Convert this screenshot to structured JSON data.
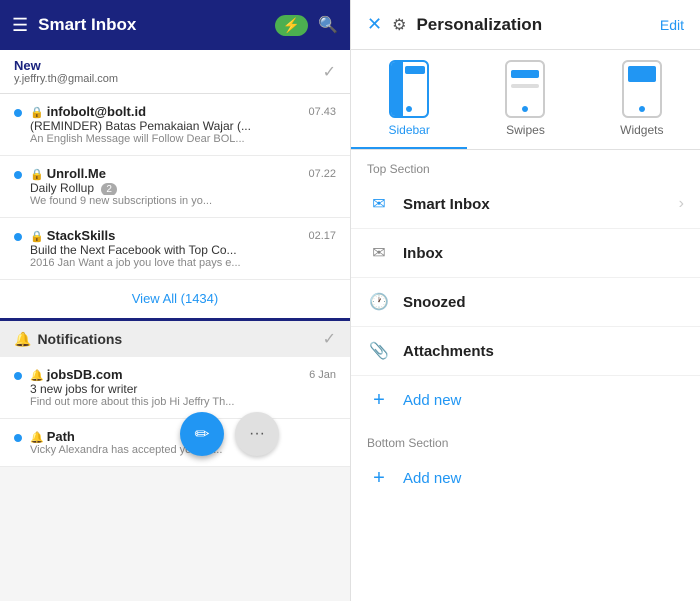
{
  "left": {
    "header": {
      "title": "Smart Inbox",
      "menu_icon": "☰",
      "search_icon": "🔍",
      "bolt_icon": "⚡"
    },
    "new_section": {
      "label": "New",
      "email": "y.jeffry.th@gmail.com",
      "check_icon": "○✓"
    },
    "emails": [
      {
        "sender": "infobolt@bolt.id",
        "time": "07.43",
        "subject": "(REMINDER) Batas Pemakaian Wajar (...",
        "preview": "An English Message will Follow Dear BOL...",
        "has_dot": true
      },
      {
        "sender": "Unroll.Me",
        "time": "07.22",
        "subject": "Daily Rollup",
        "preview": "We found 9 new subscriptions in yo...",
        "badge": "2",
        "has_dot": true
      },
      {
        "sender": "StackSkills",
        "time": "02.17",
        "subject": "Build the Next Facebook with Top Co...",
        "preview": "2016 Jan Want a job you love that pays e...",
        "has_dot": true
      }
    ],
    "view_all": "View All (1434)",
    "notifications_section": {
      "title": "Notifications"
    },
    "notifications": [
      {
        "sender": "jobsDB.com",
        "time": "6 Jan",
        "subject": "3 new jobs for writer",
        "preview": "Find out more about this job Hi Jeffry Th...",
        "has_dot": true
      },
      {
        "sender": "Path",
        "time": "",
        "subject": "",
        "preview": "Vicky Alexandra has accepted your fri...",
        "has_dot": true
      }
    ],
    "fab_icon": "✏",
    "more_icon": "···"
  },
  "right": {
    "header": {
      "close_icon": "✕",
      "personalize_icon": "⚙",
      "title": "Personalization",
      "edit_label": "Edit"
    },
    "tabs": [
      {
        "label": "Sidebar",
        "active": true,
        "type": "sidebar"
      },
      {
        "label": "Swipes",
        "active": false,
        "type": "swipes"
      },
      {
        "label": "Widgets",
        "active": false,
        "type": "widgets"
      }
    ],
    "top_section_label": "Top Section",
    "menu_items": [
      {
        "icon": "✉",
        "icon_color": "#2196f3",
        "text": "Smart Inbox",
        "has_chevron": true
      },
      {
        "icon": "✉",
        "icon_color": "#888",
        "text": "Inbox",
        "has_chevron": false
      },
      {
        "icon": "🕐",
        "icon_color": "#ff6f00",
        "text": "Snoozed",
        "has_chevron": false
      },
      {
        "icon": "📎",
        "icon_color": "#fbc02d",
        "text": "Attachments",
        "has_chevron": false
      }
    ],
    "top_add_label": "Add new",
    "bottom_section_label": "Bottom Section",
    "bottom_add_label": "Add new"
  }
}
